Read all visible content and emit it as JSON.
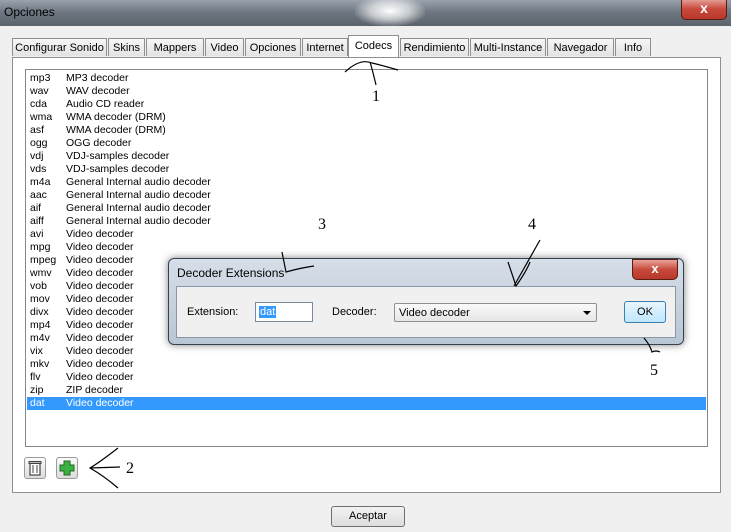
{
  "window": {
    "title": "Opciones",
    "close_glyph": "x"
  },
  "tabs": [
    {
      "label": "Configurar Sonido"
    },
    {
      "label": "Skins"
    },
    {
      "label": "Mappers"
    },
    {
      "label": "Video"
    },
    {
      "label": "Opciones"
    },
    {
      "label": "Internet"
    },
    {
      "label": "Codecs",
      "active": true
    },
    {
      "label": "Rendimiento"
    },
    {
      "label": "Multi-Instance"
    },
    {
      "label": "Navegador"
    },
    {
      "label": "Info"
    }
  ],
  "codecs": [
    {
      "ext": "mp3",
      "decoder": "MP3 decoder"
    },
    {
      "ext": "wav",
      "decoder": "WAV decoder"
    },
    {
      "ext": "cda",
      "decoder": "Audio CD reader"
    },
    {
      "ext": "wma",
      "decoder": "WMA decoder (DRM)"
    },
    {
      "ext": "asf",
      "decoder": "WMA decoder (DRM)"
    },
    {
      "ext": "ogg",
      "decoder": "OGG decoder"
    },
    {
      "ext": "vdj",
      "decoder": "VDJ-samples decoder"
    },
    {
      "ext": "vds",
      "decoder": "VDJ-samples decoder"
    },
    {
      "ext": "m4a",
      "decoder": "General Internal audio decoder"
    },
    {
      "ext": "aac",
      "decoder": "General Internal audio decoder"
    },
    {
      "ext": "aif",
      "decoder": "General Internal audio decoder"
    },
    {
      "ext": "aiff",
      "decoder": "General Internal audio decoder"
    },
    {
      "ext": "avi",
      "decoder": "Video decoder"
    },
    {
      "ext": "mpg",
      "decoder": "Video decoder"
    },
    {
      "ext": "mpeg",
      "decoder": "Video decoder"
    },
    {
      "ext": "wmv",
      "decoder": "Video decoder"
    },
    {
      "ext": "vob",
      "decoder": "Video decoder"
    },
    {
      "ext": "mov",
      "decoder": "Video decoder"
    },
    {
      "ext": "divx",
      "decoder": "Video decoder"
    },
    {
      "ext": "mp4",
      "decoder": "Video decoder"
    },
    {
      "ext": "m4v",
      "decoder": "Video decoder"
    },
    {
      "ext": "vix",
      "decoder": "Video decoder"
    },
    {
      "ext": "mkv",
      "decoder": "Video decoder"
    },
    {
      "ext": "flv",
      "decoder": "Video decoder"
    },
    {
      "ext": "zip",
      "decoder": "ZIP decoder"
    },
    {
      "ext": "dat",
      "decoder": "Video decoder",
      "selected": true
    }
  ],
  "toolbar": {
    "delete_icon": "trash-icon",
    "add_icon": "plus-icon"
  },
  "accept_label": "Aceptar",
  "dialog": {
    "title": "Decoder Extensions",
    "close_glyph": "x",
    "extension_label": "Extension:",
    "extension_value": "dat",
    "decoder_label": "Decoder:",
    "decoder_value": "Video decoder",
    "ok_label": "OK"
  },
  "annotations": [
    "1",
    "2",
    "3",
    "4",
    "5"
  ],
  "colors": {
    "selection": "#3399ff",
    "title_bar": "#6f7882",
    "close_button": "#c84a3c"
  }
}
